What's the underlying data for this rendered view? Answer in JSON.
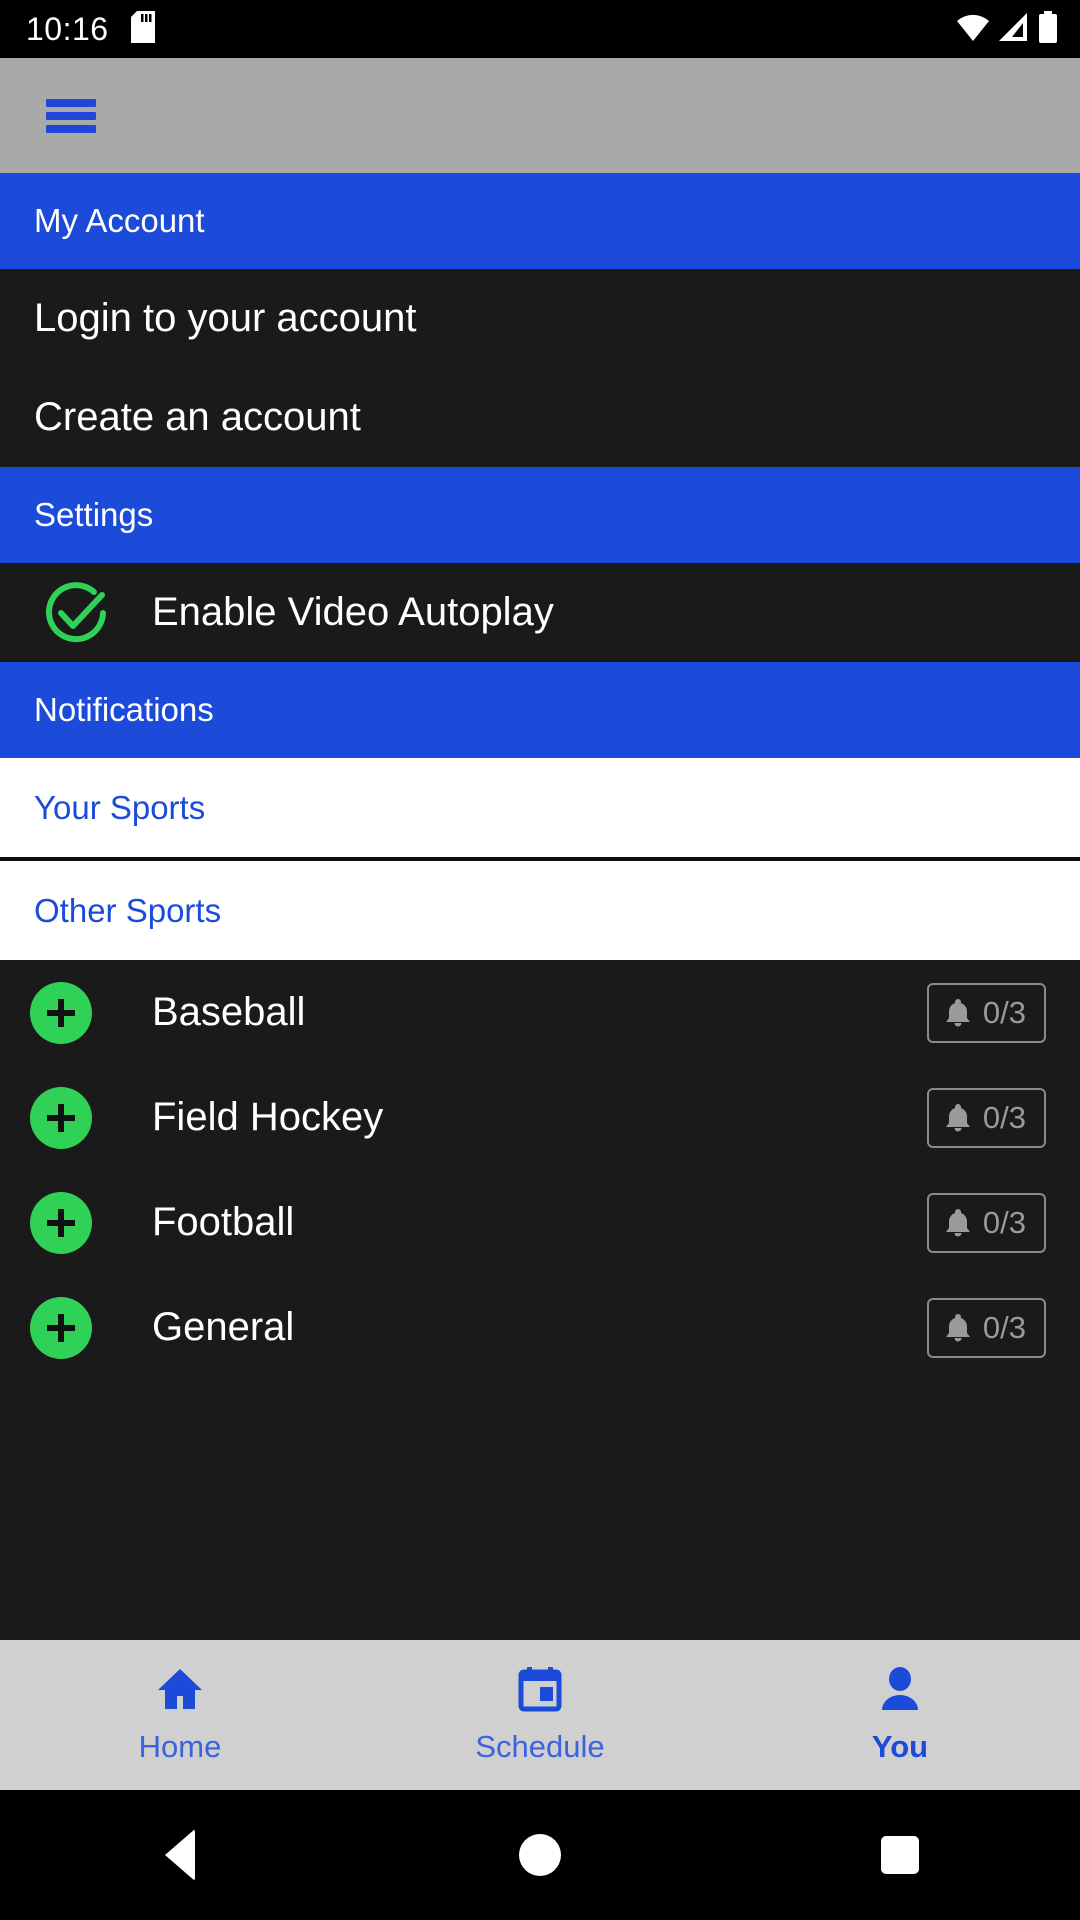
{
  "status_bar": {
    "time": "10:16",
    "sd_card_icon": "sd-card-icon",
    "wifi_icon": "wifi-icon",
    "signal_icon": "cellular-signal-icon",
    "battery_icon": "battery-icon"
  },
  "app_bar": {
    "menu_icon": "hamburger-menu-icon",
    "accent_color": "#1e46d8",
    "background_color": "#a9a9a9"
  },
  "sections": {
    "my_account": {
      "header": "My Account",
      "items": [
        {
          "label": "Login to your account"
        },
        {
          "label": "Create an account"
        }
      ]
    },
    "settings": {
      "header": "Settings",
      "autoplay": {
        "label": "Enable Video Autoplay",
        "checked": true,
        "check_icon": "check-circle-icon",
        "check_color": "#2fd256"
      }
    },
    "notifications": {
      "header": "Notifications",
      "tabs": [
        {
          "label": "Your Sports",
          "active": false
        },
        {
          "label": "Other Sports",
          "active": true
        }
      ],
      "sports": [
        {
          "name": "Baseball",
          "add_icon": "plus-circle-icon",
          "bell_icon": "bell-icon",
          "count": "0/3"
        },
        {
          "name": "Field Hockey",
          "add_icon": "plus-circle-icon",
          "bell_icon": "bell-icon",
          "count": "0/3"
        },
        {
          "name": "Football",
          "add_icon": "plus-circle-icon",
          "bell_icon": "bell-icon",
          "count": "0/3"
        },
        {
          "name": "General",
          "add_icon": "plus-circle-icon",
          "bell_icon": "bell-icon",
          "count": "0/3"
        }
      ]
    }
  },
  "bottom_nav": {
    "items": [
      {
        "label": "Home",
        "icon": "home-icon",
        "active": false
      },
      {
        "label": "Schedule",
        "icon": "calendar-icon",
        "active": false
      },
      {
        "label": "You",
        "icon": "person-icon",
        "active": true
      }
    ]
  },
  "system_nav": {
    "back_icon": "back-triangle-icon",
    "home_icon": "home-circle-icon",
    "recents_icon": "recents-square-icon"
  },
  "colors": {
    "accent_blue": "#1b4bd8",
    "header_gray": "#a9a9a9",
    "row_dark": "#1a1a1a",
    "green": "#2fd256"
  }
}
